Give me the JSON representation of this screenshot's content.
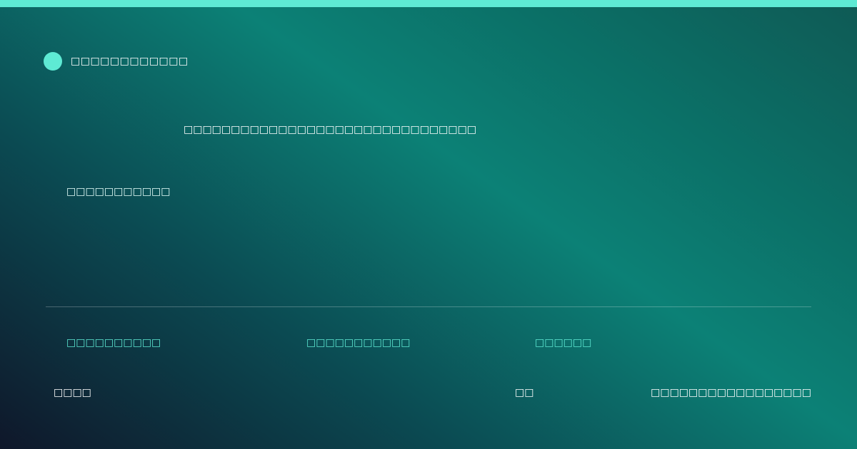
{
  "colors": {
    "accent": "#5eead4",
    "background_dark": "#0f172a",
    "background_teal": "#0c8176"
  },
  "brand": {
    "icon": "brand-dot-icon",
    "name": "□□□□□□□□□□□□"
  },
  "hero": {
    "headline": "□□□□□□□□□□□□□□□□□□□□□□□□□□□□□□□",
    "subline": "□□□□□□□□□□□"
  },
  "stats": [
    {
      "label": "□□□□□□□□□□"
    },
    {
      "label": "□□□□□□□□□□□"
    },
    {
      "label": "□□□□□□"
    }
  ],
  "footer": {
    "left": "□□□□",
    "middle": "□□",
    "right": "□□□□□□□□□□□□□□□□□"
  }
}
